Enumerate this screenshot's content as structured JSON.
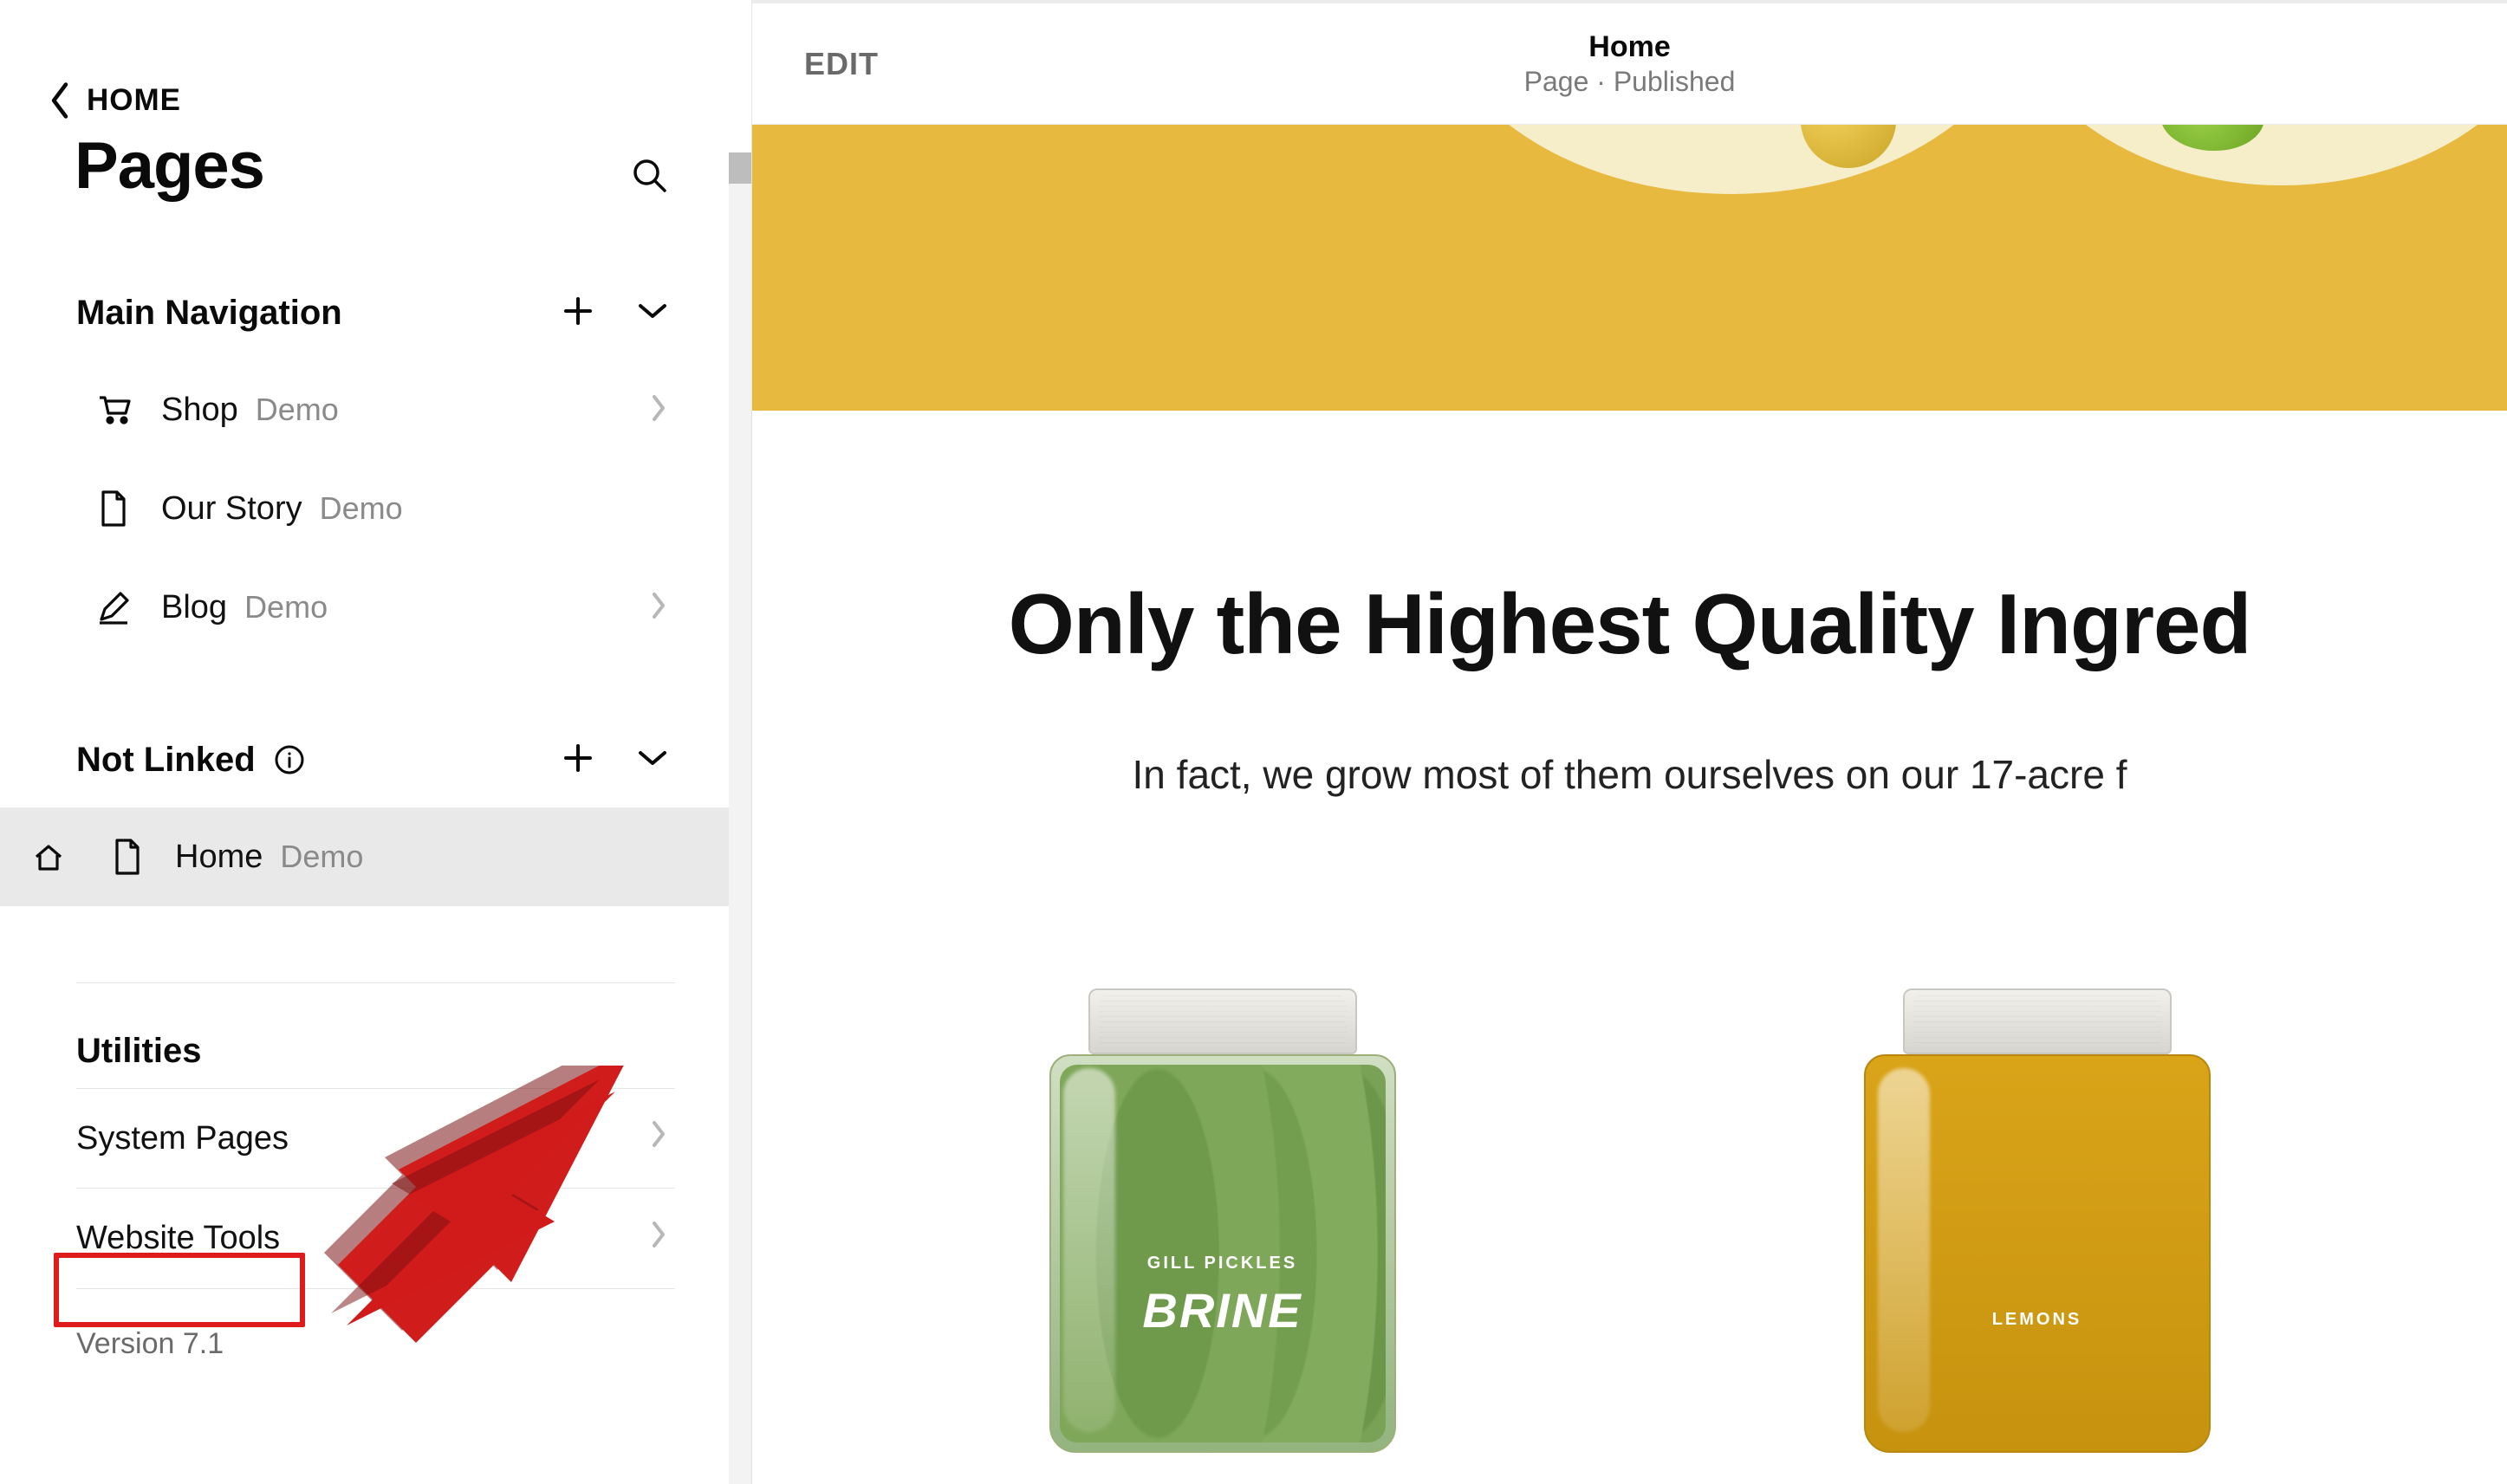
{
  "sidebar": {
    "back_label": "HOME",
    "title": "Pages",
    "sections": {
      "main_nav": {
        "title": "Main Navigation",
        "items": [
          {
            "label": "Shop",
            "tag": "Demo",
            "icon": "cart",
            "has_children": true
          },
          {
            "label": "Our Story",
            "tag": "Demo",
            "icon": "page",
            "has_children": false
          },
          {
            "label": "Blog",
            "tag": "Demo",
            "icon": "pen",
            "has_children": true
          }
        ]
      },
      "not_linked": {
        "title": "Not Linked",
        "items": [
          {
            "label": "Home",
            "tag": "Demo",
            "icon": "page",
            "is_home": true,
            "selected": true
          }
        ]
      },
      "utilities": {
        "title": "Utilities",
        "items": [
          {
            "label": "System Pages"
          },
          {
            "label": "Website Tools"
          }
        ]
      }
    },
    "version": "Version 7.1"
  },
  "preview": {
    "edit": "EDIT",
    "title": "Home",
    "subtitle": "Page · Published",
    "content": {
      "heading": "Only the Highest Quality Ingred",
      "sub": "In fact, we grow most of them ourselves on our 17-acre f",
      "products": [
        {
          "kicker": "GILL PICKLES",
          "name": "BRINE"
        },
        {
          "kicker": "LEMONS",
          "name": ""
        }
      ]
    }
  },
  "annotations": {
    "arrow_color": "#d11a1a",
    "highlight_target": "Website Tools"
  }
}
